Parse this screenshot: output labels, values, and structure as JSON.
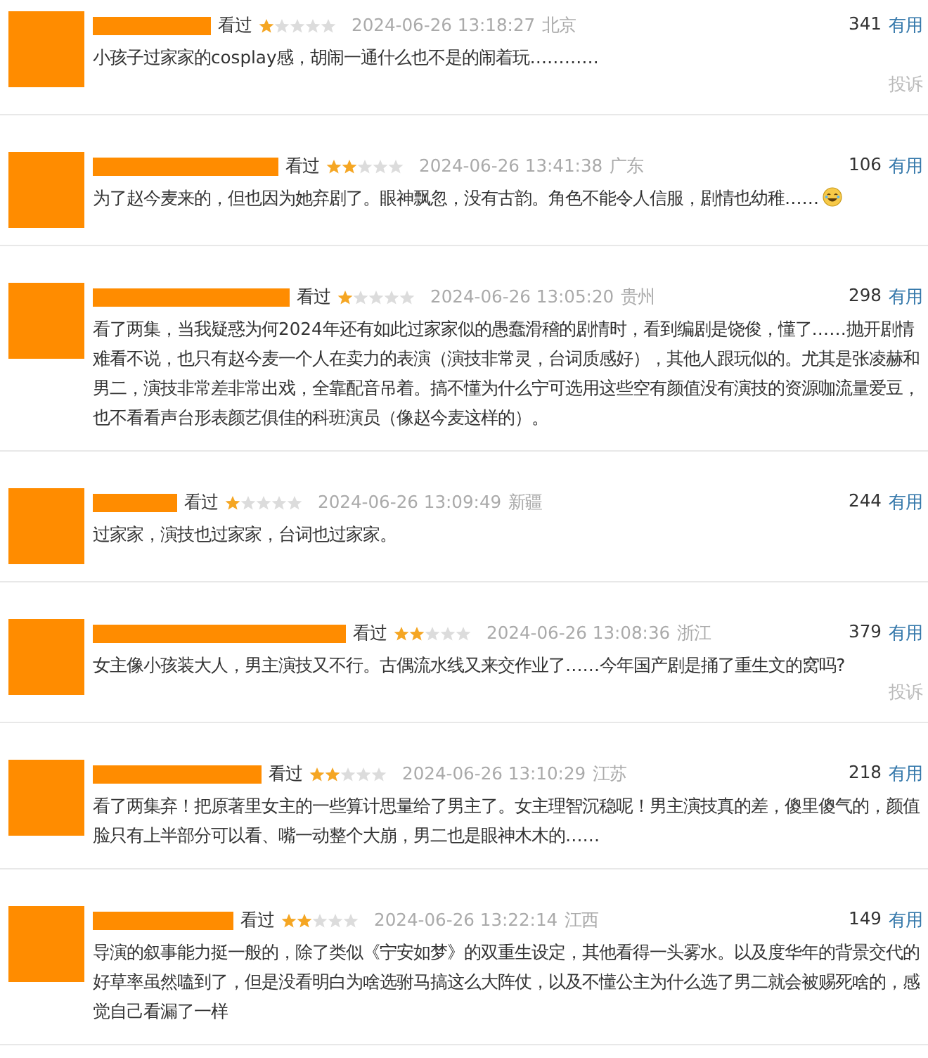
{
  "reviews": [
    {
      "status": "看过",
      "stars": 1,
      "time": "2024-06-26 13:18:27",
      "location": "北京",
      "votes": "341",
      "useful": "有用",
      "text": "小孩子过家家的cosplay感，胡闹一通什么也不是的闹着玩…………",
      "emoji": false,
      "report": "投诉"
    },
    {
      "status": "看过",
      "stars": 2,
      "time": "2024-06-26 13:41:38",
      "location": "广东",
      "votes": "106",
      "useful": "有用",
      "text": "为了赵今麦来的，但也因为她弃剧了。眼神飘忽，没有古韵。角色不能令人信服，剧情也幼稚……",
      "emoji": true
    },
    {
      "status": "看过",
      "stars": 1,
      "time": "2024-06-26 13:05:20",
      "location": "贵州",
      "votes": "298",
      "useful": "有用",
      "text": "看了两集，当我疑惑为何2024年还有如此过家家似的愚蠢滑稽的剧情时，看到编剧是饶俊，懂了……抛开剧情难看不说，也只有赵今麦一个人在卖力的表演（演技非常灵，台词质感好），其他人跟玩似的。尤其是张凌赫和男二，演技非常差非常出戏，全靠配音吊着。搞不懂为什么宁可选用这些空有颜值没有演技的资源咖流量爱豆，也不看看声台形表颜艺俱佳的科班演员（像赵今麦这样的）。",
      "emoji": false
    },
    {
      "status": "看过",
      "stars": 1,
      "time": "2024-06-26 13:09:49",
      "location": "新疆",
      "votes": "244",
      "useful": "有用",
      "text": "过家家，演技也过家家，台词也过家家。",
      "emoji": false
    },
    {
      "status": "看过",
      "stars": 2,
      "time": "2024-06-26 13:08:36",
      "location": "浙江",
      "votes": "379",
      "useful": "有用",
      "text": "女主像小孩装大人，男主演技又不行。古偶流水线又来交作业了……今年国产剧是捅了重生文的窝吗?",
      "emoji": false,
      "report": "投诉"
    },
    {
      "status": "看过",
      "stars": 2,
      "time": "2024-06-26 13:10:29",
      "location": "江苏",
      "votes": "218",
      "useful": "有用",
      "text": "看了两集弃！把原著里女主的一些算计思量给了男主了。女主理智沉稳呢！男主演技真的差，傻里傻气的，颜值脸只有上半部分可以看、嘴一动整个大崩，男二也是眼神木木的……",
      "emoji": false
    },
    {
      "status": "看过",
      "stars": 2,
      "time": "2024-06-26 13:22:14",
      "location": "江西",
      "votes": "149",
      "useful": "有用",
      "text": "导演的叙事能力挺一般的，除了类似《宁安如梦》的双重生设定，其他看得一头雾水。以及度华年的背景交代的好草率虽然嗑到了，但是没看明白为啥选驸马搞这么大阵仗，以及不懂公主为什么选了男二就会被赐死啥的，感觉自己看漏了一样",
      "emoji": false
    }
  ]
}
